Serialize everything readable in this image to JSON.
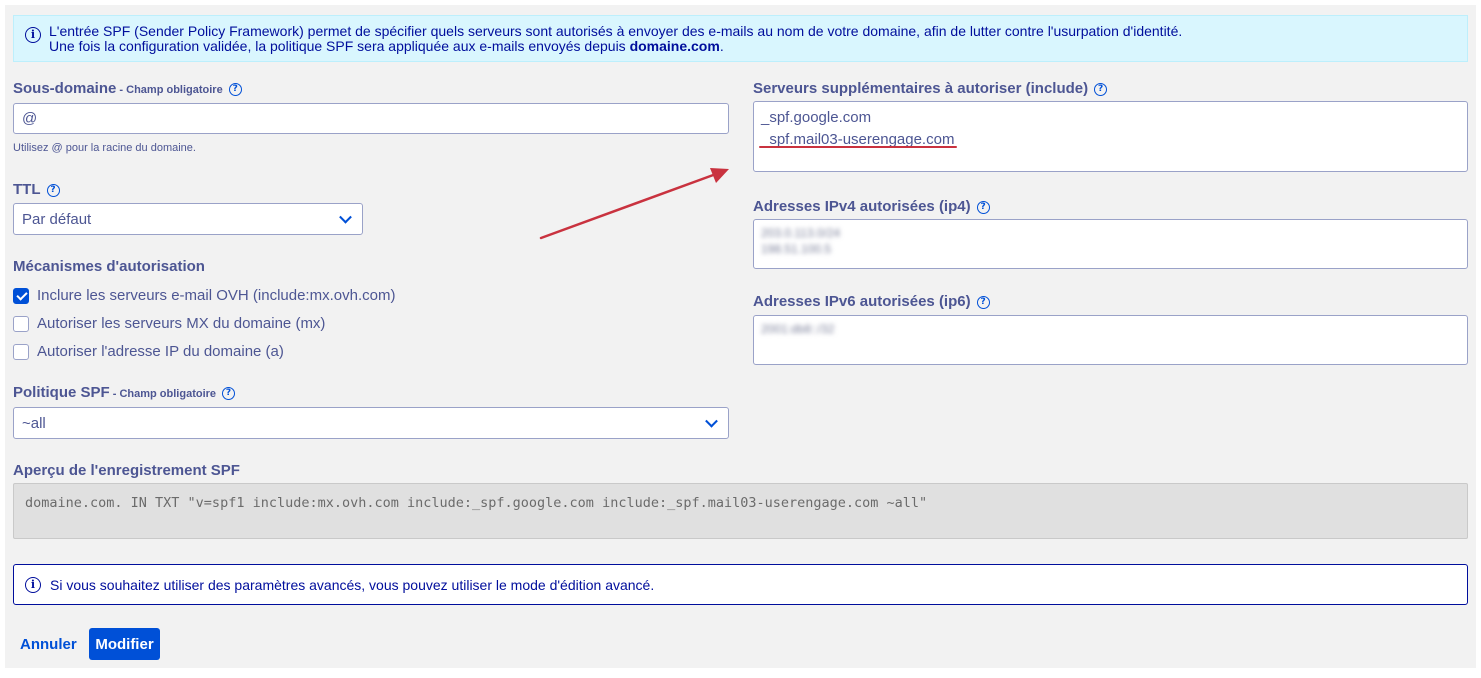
{
  "info_top": {
    "line1": "L'entrée SPF (Sender Policy Framework) permet de spécifier quels serveurs sont autorisés à envoyer des e-mails au nom de votre domaine, afin de lutter contre l'usurpation d'identité.",
    "line2_prefix": "Une fois la configuration validée, la politique SPF sera appliquée aux e-mails envoyés depuis ",
    "line2_domain": "domaine.com",
    "line2_suffix": "."
  },
  "subdomain": {
    "label": "Sous-domaine",
    "required": " - Champ obligatoire",
    "value": "@",
    "hint": "Utilisez @ pour la racine du domaine."
  },
  "ttl": {
    "label": "TTL",
    "value": "Par défaut"
  },
  "mechanisms": {
    "label": "Mécanismes d'autorisation",
    "items": [
      {
        "label": "Inclure les serveurs e-mail OVH (include:mx.ovh.com)",
        "checked": true
      },
      {
        "label": "Autoriser les serveurs MX du domaine (mx)",
        "checked": false
      },
      {
        "label": "Autoriser l'adresse IP du domaine (a)",
        "checked": false
      }
    ]
  },
  "policy": {
    "label": "Politique SPF",
    "required": " - Champ obligatoire",
    "value": "~all"
  },
  "include": {
    "label": "Serveurs supplémentaires à autoriser (include)",
    "values": [
      "_spf.google.com",
      "_spf.mail03-userengage.com"
    ]
  },
  "ip4": {
    "label": "Adresses IPv4 autorisées (ip4)",
    "values": [
      "203.0.113.0/24",
      "198.51.100.5"
    ]
  },
  "ip6": {
    "label": "Adresses IPv6 autorisées (ip6)",
    "values": [
      "2001:db8::/32"
    ]
  },
  "preview": {
    "label": "Aperçu de l'enregistrement SPF",
    "value": "domaine.com. IN TXT \"v=spf1 include:mx.ovh.com include:_spf.google.com include:_spf.mail03-userengage.com ~all\""
  },
  "info_bottom": {
    "text": "Si vous souhaitez utiliser des paramètres avancés, vous pouvez utiliser le mode d'édition avancé."
  },
  "actions": {
    "cancel": "Annuler",
    "modify": "Modifier"
  },
  "colors": {
    "primary": "#0050d7",
    "text": "#4d5693",
    "info_bg": "#d9f6fe",
    "annotation": "#c9323f"
  }
}
